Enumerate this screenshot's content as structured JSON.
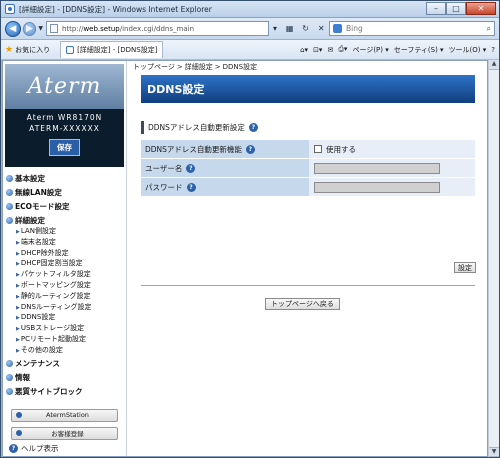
{
  "window": {
    "title": "[詳細設定] - [DDNS設定] - Windows Internet Explorer"
  },
  "address_bar": {
    "url_prefix": "http://",
    "url_host": "web.setup",
    "url_path": "/index.cgi/ddns_main",
    "search_placeholder": "Bing"
  },
  "favorites_bar": {
    "favorites_label": "お気に入り",
    "tab_label": "[詳細設定] - [DDNS設定]",
    "commands": [
      "ページ(P) ▾",
      "セーフティ(S) ▾",
      "ツール(O) ▾",
      "?"
    ]
  },
  "sidebar": {
    "logo": "Aterm",
    "model_line1": "Aterm WR8170N",
    "model_line2": "ATERM-XXXXXX",
    "save_label": "保存",
    "top_menus": [
      {
        "label": "基本設定"
      },
      {
        "label": "無線LAN設定"
      },
      {
        "label": "ECOモード設定"
      },
      {
        "label": "詳細設定"
      }
    ],
    "sub_items": [
      "LAN側設定",
      "端末名設定",
      "DHCP除外設定",
      "DHCP固定割当設定",
      "パケットフィルタ設定",
      "ポートマッピング設定",
      "静的ルーティング設定",
      "DNSルーティング設定",
      "DDNS設定",
      "USBストレージ設定",
      "PCリモート起動設定",
      "その他の設定"
    ],
    "bottom_menus": [
      {
        "label": "メンテナンス"
      },
      {
        "label": "情報"
      },
      {
        "label": "悪質サイトブロック"
      }
    ],
    "aterm_station_label": "AtermStation",
    "customer_register_label": "お客様登録",
    "help_label": "ヘルプ表示"
  },
  "main": {
    "breadcrumb": [
      "トップページ",
      "詳細設定",
      "DDNS設定"
    ],
    "page_title": "DDNS設定",
    "section_title": "DDNSアドレス自動更新設定",
    "rows": {
      "ddns_function_label": "DDNSアドレス自動更新機能",
      "use_label": "使用する",
      "username_label": "ユーザー名",
      "password_label": "パスワード"
    },
    "set_button_label": "設定",
    "back_button_label": "トップページへ戻る"
  }
}
